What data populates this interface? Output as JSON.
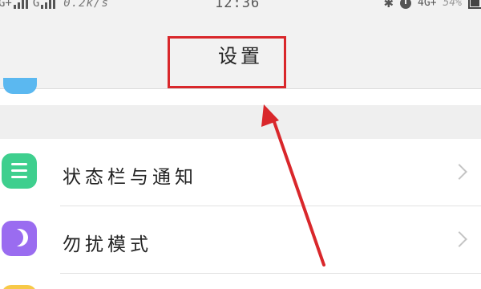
{
  "status_bar": {
    "sim1_network": "G+",
    "sim2_network": "G",
    "speed": "0.2k/s",
    "time": "12:36",
    "mobile_data": "4G+",
    "battery_percent": "54%"
  },
  "header": {
    "title": "设置"
  },
  "settings": {
    "items": [
      {
        "label": "状态栏与通知",
        "icon": "notification-lines-icon",
        "icon_color": "#3ecf8e"
      },
      {
        "label": "勿扰模式",
        "icon": "moon-icon",
        "icon_color": "#9a6cf0"
      }
    ]
  },
  "colors": {
    "annotation_red": "#d9272b",
    "partial_icon_top": "#5bb8f0",
    "partial_icon_bottom": "#f7c948"
  }
}
